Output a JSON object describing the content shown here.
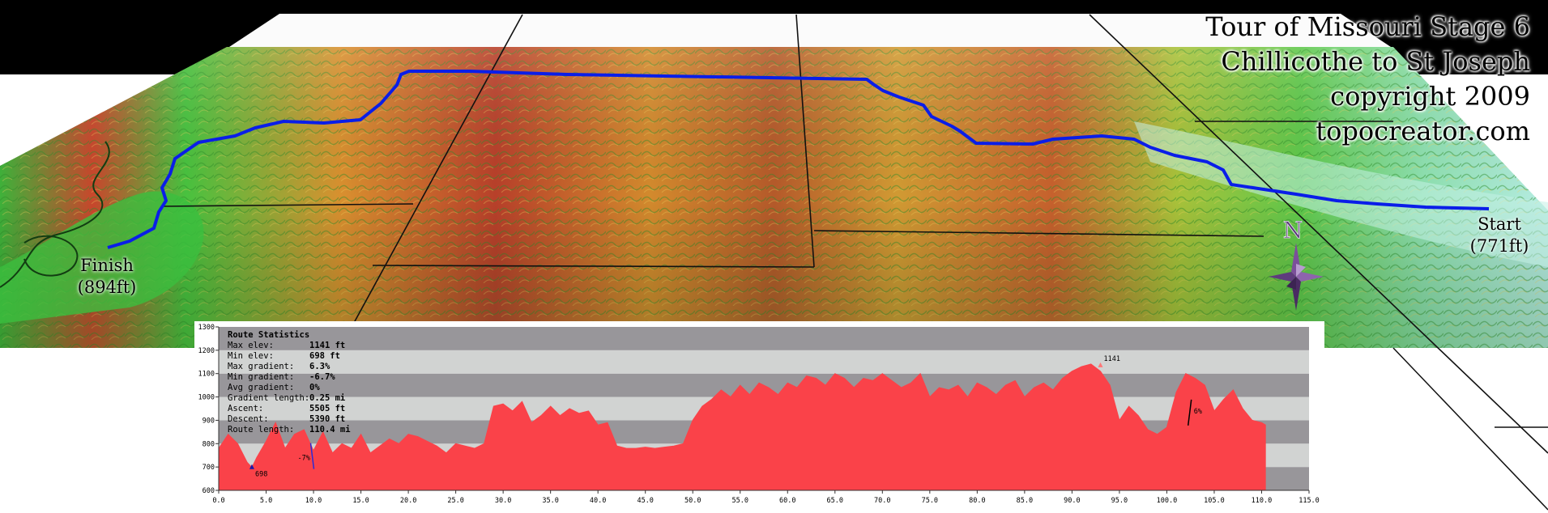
{
  "title": {
    "line1": "Tour of Missouri Stage 6",
    "line2": "Chillicothe to St Joseph",
    "line3": "copyright 2009",
    "line4": "topocreator.com"
  },
  "map": {
    "finish_label": "Finish",
    "finish_elev": "(894ft)",
    "start_label": "Start",
    "start_elev": "(771ft)",
    "compass_letter": "N",
    "route_color": "#0a1ee8"
  },
  "stats": {
    "heading": "Route Statistics",
    "rows": [
      {
        "label": "Max elev:",
        "value": "1141 ft"
      },
      {
        "label": "Min elev:",
        "value": "698 ft"
      },
      {
        "label": "Max gradient:",
        "value": "6.3%"
      },
      {
        "label": "Min gradient:",
        "value": "-6.7%"
      },
      {
        "label": "Avg gradient:",
        "value": "0%"
      },
      {
        "label": "Gradient length:",
        "value": "0.25 mi"
      },
      {
        "label": "Ascent:",
        "value": "5505 ft"
      },
      {
        "label": "Descent:",
        "value": "5390 ft"
      },
      {
        "label": "Route length:",
        "value": "110.4 mi"
      }
    ]
  },
  "chart_data": {
    "type": "area",
    "title": "",
    "xlabel": "",
    "ylabel": "",
    "xlim": [
      0,
      115
    ],
    "ylim": [
      600,
      1300
    ],
    "grid": "horizontal bands",
    "fill_color": "#fa4249",
    "x_ticks": [
      "0.0",
      "5.0",
      "10.0",
      "15.0",
      "20.0",
      "25.0",
      "30.0",
      "35.0",
      "40.0",
      "45.0",
      "50.0",
      "55.0",
      "60.0",
      "65.0",
      "70.0",
      "75.0",
      "80.0",
      "85.0",
      "90.0",
      "95.0",
      "100.0",
      "105.0",
      "110.0",
      "115.0"
    ],
    "y_ticks": [
      "600",
      "700",
      "800",
      "900",
      "1000",
      "1100",
      "1200",
      "1300"
    ],
    "x": [
      0,
      1,
      2,
      3,
      3.5,
      4,
      5,
      6,
      7,
      8,
      9,
      10,
      11,
      12,
      13,
      14,
      15,
      16,
      17,
      18,
      19,
      20,
      21,
      22,
      23,
      24,
      25,
      26,
      27,
      28,
      29,
      30,
      31,
      32,
      33,
      34,
      35,
      36,
      37,
      38,
      39,
      40,
      41,
      42,
      43,
      44,
      45,
      46,
      47,
      48,
      49,
      50,
      51,
      52,
      53,
      54,
      55,
      56,
      57,
      58,
      59,
      60,
      61,
      62,
      63,
      64,
      65,
      66,
      67,
      68,
      69,
      70,
      71,
      72,
      73,
      74,
      75,
      76,
      77,
      78,
      79,
      80,
      81,
      82,
      83,
      84,
      85,
      86,
      87,
      88,
      89,
      90,
      91,
      92,
      93,
      94,
      95,
      96,
      97,
      98,
      99,
      100,
      101,
      102,
      103,
      104,
      105,
      106,
      107,
      108,
      109,
      110,
      110.4
    ],
    "y": [
      780,
      840,
      800,
      720,
      698,
      740,
      810,
      890,
      780,
      840,
      860,
      770,
      850,
      760,
      800,
      780,
      840,
      760,
      790,
      820,
      800,
      840,
      830,
      810,
      790,
      760,
      800,
      790,
      780,
      800,
      960,
      970,
      940,
      980,
      890,
      920,
      960,
      920,
      950,
      930,
      940,
      880,
      890,
      790,
      780,
      780,
      785,
      780,
      785,
      790,
      800,
      900,
      960,
      990,
      1030,
      1000,
      1050,
      1010,
      1060,
      1040,
      1010,
      1060,
      1040,
      1090,
      1080,
      1050,
      1100,
      1080,
      1040,
      1080,
      1070,
      1100,
      1070,
      1040,
      1060,
      1100,
      1000,
      1040,
      1030,
      1050,
      1000,
      1060,
      1040,
      1010,
      1050,
      1070,
      1000,
      1040,
      1060,
      1030,
      1080,
      1110,
      1130,
      1141,
      1110,
      1050,
      900,
      960,
      920,
      860,
      840,
      870,
      1020,
      1100,
      1080,
      1050,
      940,
      990,
      1030,
      950,
      900,
      890,
      880
    ],
    "annotations": [
      {
        "text": "698",
        "x": 3.5,
        "y": 698
      },
      {
        "text": "1141",
        "x": 93,
        "y": 1141
      },
      {
        "text": "6%",
        "x": 102.5,
        "y": 940
      },
      {
        "text": "-7%",
        "x": 8.5,
        "y": 740
      }
    ]
  }
}
